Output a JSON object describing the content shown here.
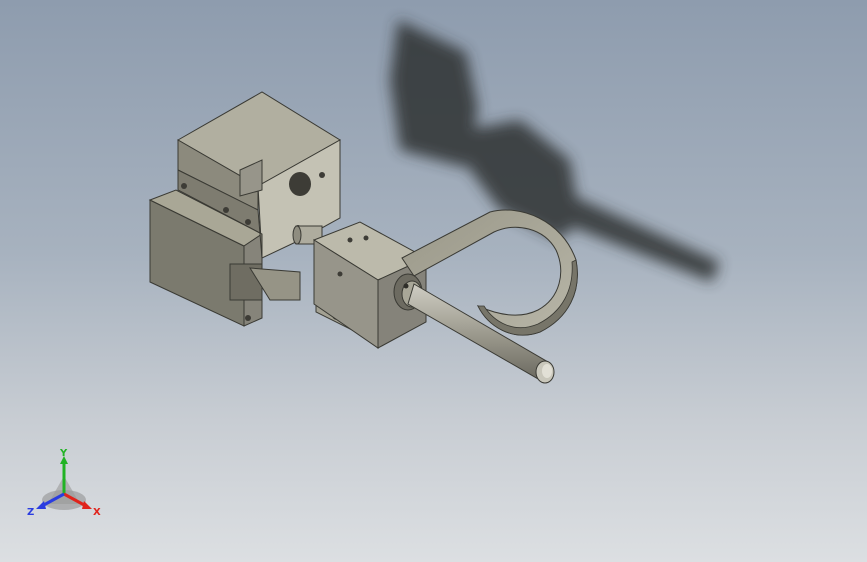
{
  "viewport": {
    "background_top": "#8e9cae",
    "background_bottom": "#dcdfe2",
    "part_color": "#8f8d80",
    "shadow_color": "#2e3033"
  },
  "triad": {
    "x_label": "X",
    "y_label": "Y",
    "z_label": "Z",
    "x_color": "#e0241c",
    "y_color": "#21b324",
    "z_color": "#2a3de0"
  }
}
